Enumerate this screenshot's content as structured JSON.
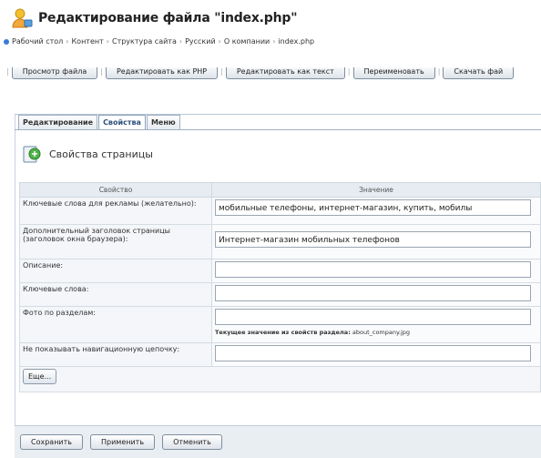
{
  "header": {
    "title": "Редактирование файла \"index.php\"",
    "icon": "user-edit-icon"
  },
  "breadcrumb": [
    "Рабочий стол",
    "Контент",
    "Структура сайта",
    "Русский",
    "О компании",
    "index.php"
  ],
  "toolbar": [
    "Просмотр файла",
    "Редактировать как PHP",
    "Редактировать как текст",
    "Переименовать",
    "Скачать фай"
  ],
  "tabs": [
    {
      "label": "Редактирование",
      "active": false
    },
    {
      "label": "Свойства",
      "active": true
    },
    {
      "label": "Меню",
      "active": false
    }
  ],
  "section": {
    "title": "Свойства страницы",
    "icon": "page-properties-icon"
  },
  "table": {
    "headers": [
      "Свойство",
      "Значение"
    ],
    "rows": [
      {
        "label": "Ключевые слова для рекламы (желательно):",
        "value": "мобильные телефоны, интернет-магазин, купить, мобилы"
      },
      {
        "label": "Дополнительный заголовок страницы (заголовок окна браузера):",
        "value": "Интернет-магазин мобильных телефонов"
      },
      {
        "label": "Описание:",
        "value": ""
      },
      {
        "label": "Ключевые слова:",
        "value": ""
      },
      {
        "label": "Фото по разделам:",
        "value": "",
        "hint_label": "Текущее значение из свойств раздела:",
        "hint_value": "about_company.jpg"
      },
      {
        "label": "Не показывать навигационную цепочку:",
        "value": ""
      }
    ],
    "more_label": "Еще..."
  },
  "footer": {
    "save_label": "Сохранить",
    "apply_label": "Применить",
    "cancel_label": "Отменить"
  },
  "colors": {
    "accent": "#2d4f7a",
    "tab_border": "#9fb0c4",
    "footer_bg": "#e9eef3"
  }
}
